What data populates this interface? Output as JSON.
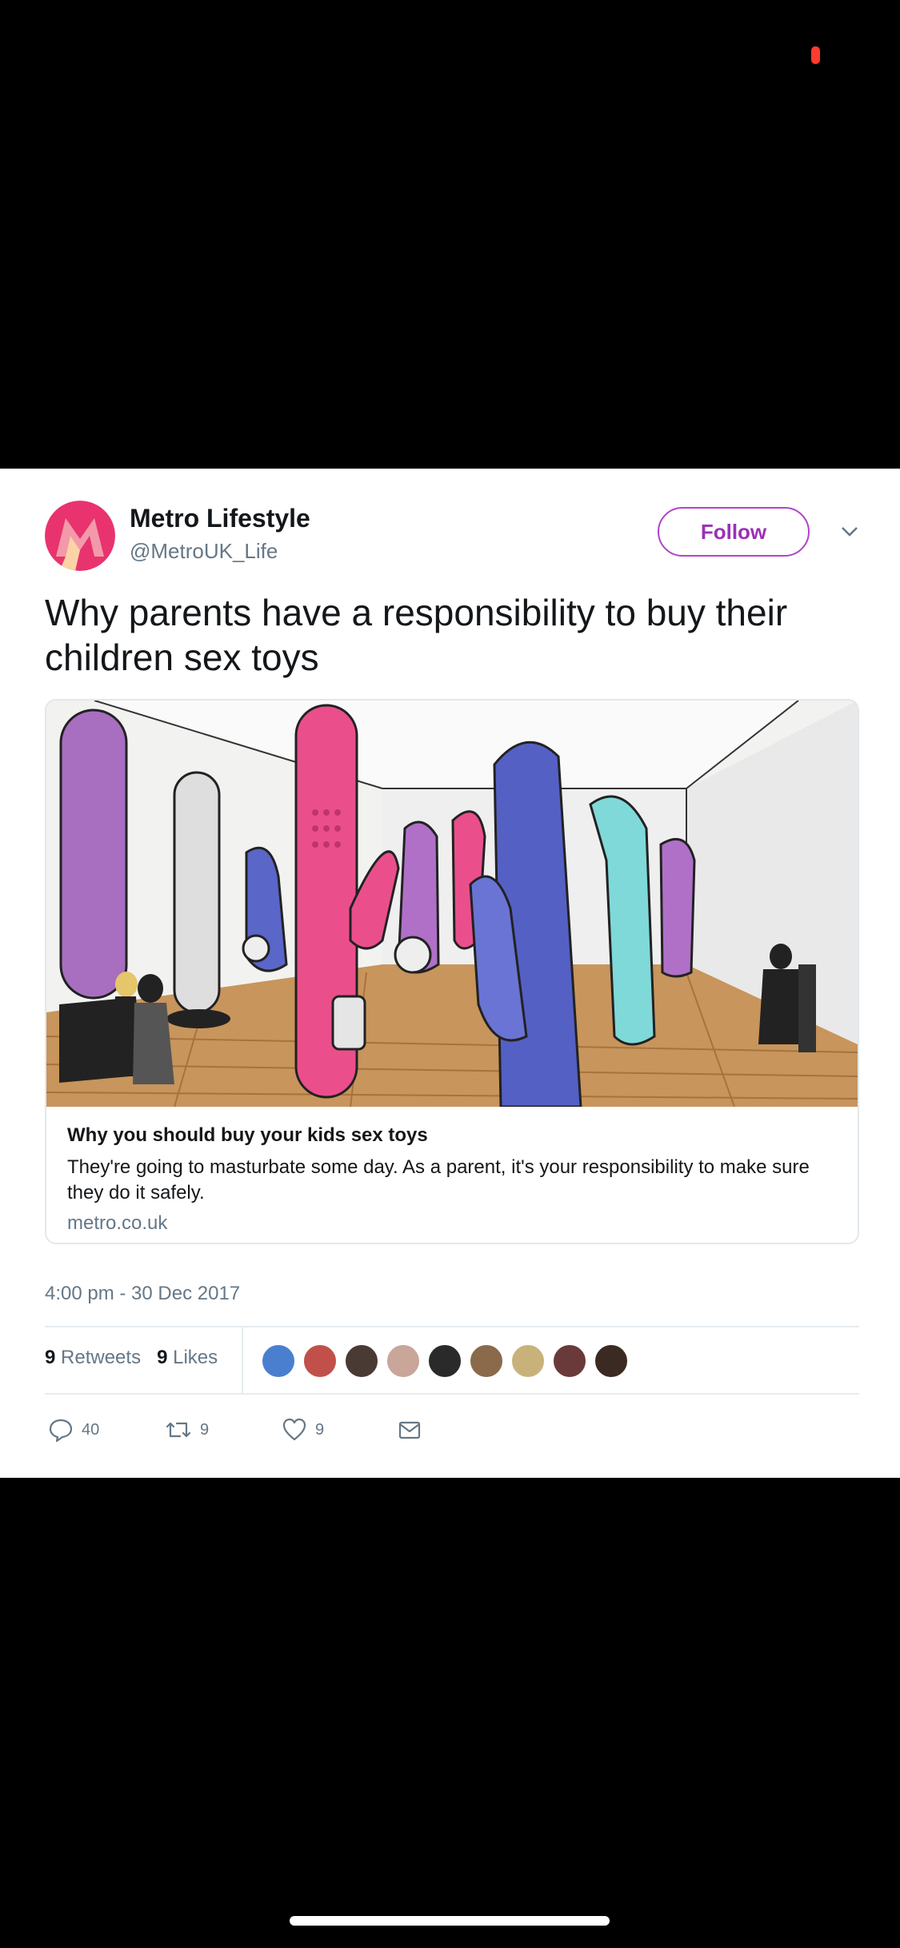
{
  "tweet": {
    "author_name": "Metro Lifestyle",
    "author_handle": "@MetroUK_Life",
    "follow_label": "Follow",
    "text": "Why parents have a responsibility to buy their children sex toys",
    "card": {
      "title": "Why you should buy your kids sex toys",
      "description": "They're going to masturbate some day. As a parent, it's your responsibility to make sure they do it safely.",
      "domain": "metro.co.uk"
    },
    "timestamp": "4:00 pm - 30 Dec 2017",
    "stats": {
      "retweets_count": "9",
      "retweets_label": "Retweets",
      "likes_count": "9",
      "likes_label": "Likes"
    },
    "actions": {
      "replies": "40",
      "retweets": "9",
      "likes": "9"
    }
  },
  "colors": {
    "brand_pink": "#e8336f",
    "follow_purple": "#9b30b8",
    "secondary_text": "#657786"
  }
}
